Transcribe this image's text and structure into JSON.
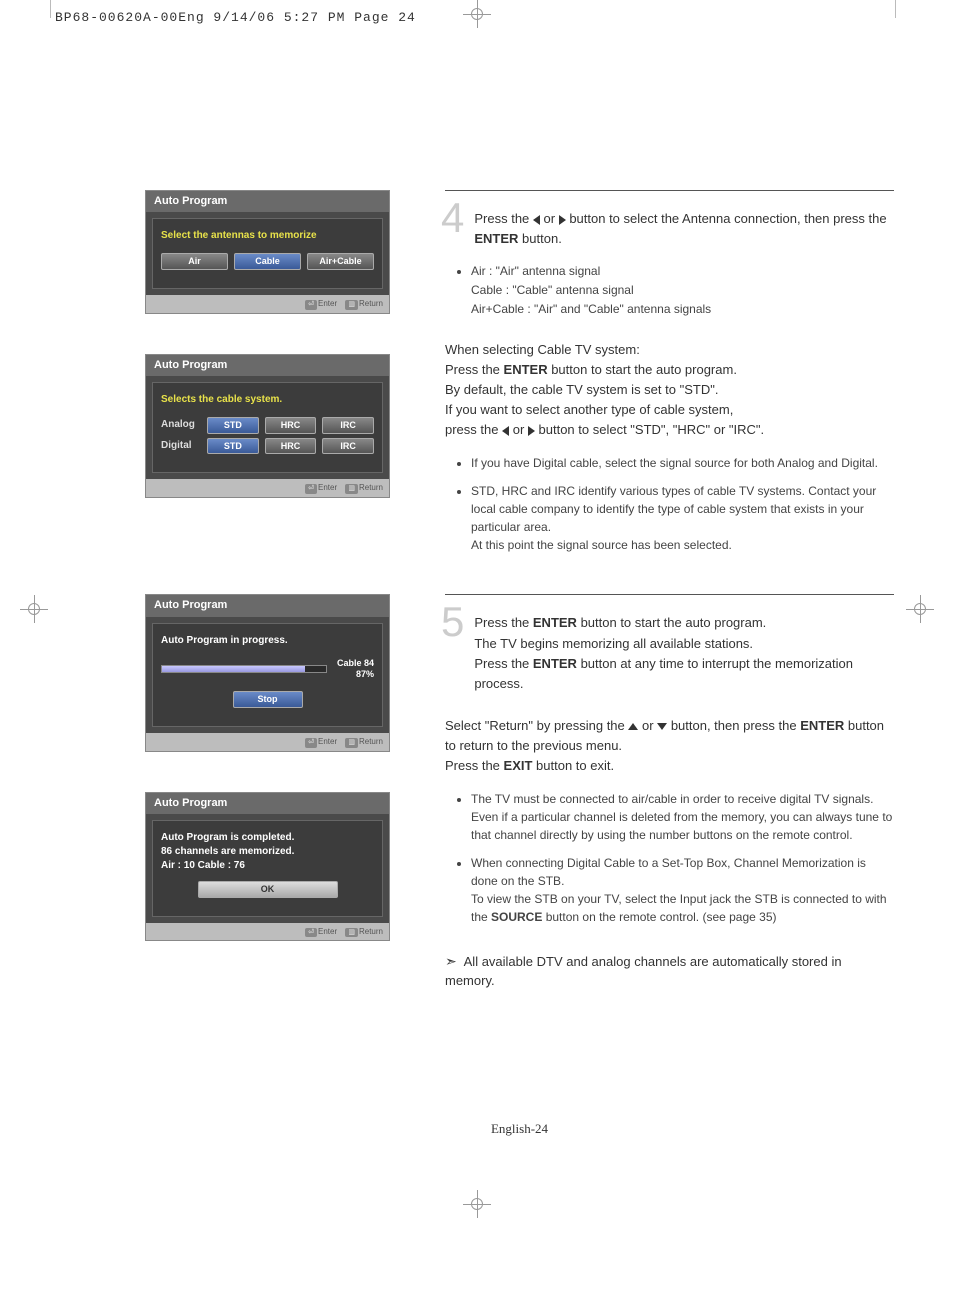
{
  "print_header": "BP68-00620A-00Eng  9/14/06  5:27 PM  Page 24",
  "osd1": {
    "title": "Auto Program",
    "subtitle": "Select the antennas to memorize",
    "buttons": [
      "Air",
      "Cable",
      "Air+Cable"
    ],
    "foot_enter": "Enter",
    "foot_return": "Return"
  },
  "osd2": {
    "title": "Auto Program",
    "subtitle": "Selects the cable system.",
    "row1_label": "Analog",
    "row2_label": "Digital",
    "opts": [
      "STD",
      "HRC",
      "IRC"
    ],
    "foot_enter": "Enter",
    "foot_return": "Return"
  },
  "osd3": {
    "title": "Auto Program",
    "subtitle": "Auto Program in progress.",
    "channel": "Cable 84",
    "percent": "87%",
    "stop": "Stop",
    "foot_enter": "Enter",
    "foot_return": "Return"
  },
  "osd4": {
    "title": "Auto Program",
    "line1": "Auto Program is completed.",
    "line2": "86 channels are memorized.",
    "line3": "Air : 10    Cable : 76",
    "ok": "OK",
    "foot_enter": "Enter",
    "foot_return": "Return"
  },
  "step4": {
    "num": "4",
    "line1a": "Press the ",
    "line1b": " or ",
    "line1c": " button to select the Antenna connection, then press the ",
    "enter": "ENTER",
    "line1d": " button.",
    "b1": "Air : \"Air\" antenna signal",
    "b2": "Cable : \"Cable\" antenna signal",
    "b3": "Air+Cable : \"Air\" and \"Cable\" antenna signals",
    "d1": "When selecting Cable TV system:",
    "d2a": "Press the ",
    "d2b": " button to start the auto program.",
    "d3": "By default, the cable TV system is set to \"STD\".",
    "d4": "If you want to select another type of cable system,",
    "d5a": "press the ",
    "d5b": " or ",
    "d5c": " button to select  \"STD\", \"HRC\" or \"IRC\".",
    "sb1": "If you have Digital cable, select the signal source for both Analog and Digital.",
    "sb2": "STD, HRC and IRC identify various types of cable TV systems. Contact your local cable company to identify the type of cable system that exists in your particular area.",
    "sb2b": "At this point the signal source has been selected."
  },
  "step5": {
    "num": "5",
    "l1a": "Press the ",
    "enter": "ENTER",
    "l1b": " button to start the auto program.",
    "l2": "The TV begins memorizing all available stations.",
    "l3a": "Press the ",
    "l3b": " button at any time to interrupt the memorization process.",
    "r1a": "Select \"Return\" by pressing the ",
    "r1b": " or ",
    "r1c": " button, then press the ",
    "r1d": " button to return to the previous menu.",
    "r2a": "Press the ",
    "exit": "EXIT",
    "r2b": " button to exit.",
    "sb1": "The TV must be connected to air/cable in order to receive digital TV signals. Even if a particular channel is deleted from the memory, you can always tune to that channel directly by using the number buttons on the remote control.",
    "sb2": "When connecting Digital Cable to a Set-Top Box, Channel Memorization is done on the STB.",
    "sb2b_a": "To view the STB on your TV, select the Input jack the STB is connected to with the ",
    "source": "SOURCE",
    "sb2b_b": " button on the remote control. (see page 35)"
  },
  "final_note": "All available DTV and analog channels are automatically stored in memory.",
  "footer": "English-24"
}
